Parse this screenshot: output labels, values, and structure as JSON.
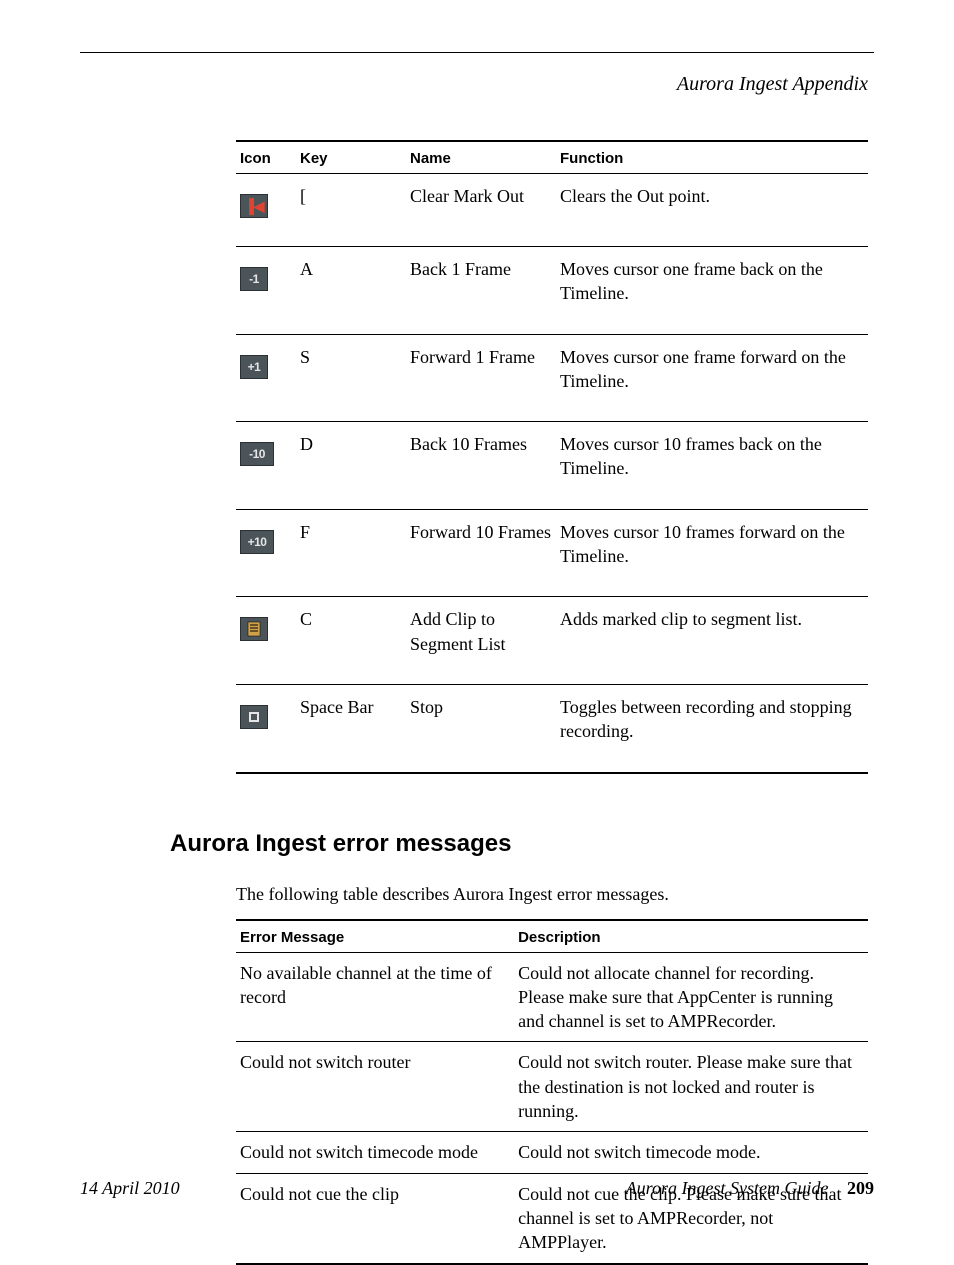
{
  "header": {
    "title": "Aurora Ingest Appendix"
  },
  "table1": {
    "headers": {
      "icon": "Icon",
      "key": "Key",
      "name": "Name",
      "function": "Function"
    },
    "rows": [
      {
        "icon_name": "clear-mark-out-icon",
        "icon_label": "",
        "icon_kind": "red-start",
        "key": "[",
        "name": "Clear Mark Out",
        "function": "Clears the Out point."
      },
      {
        "icon_name": "back-1-frame-icon",
        "icon_label": "-1",
        "icon_kind": "text",
        "key": "A",
        "name": "Back 1 Frame",
        "function": "Moves cursor one frame back on the Timeline."
      },
      {
        "icon_name": "forward-1-frame-icon",
        "icon_label": "+1",
        "icon_kind": "text",
        "key": "S",
        "name": "Forward 1 Frame",
        "function": "Moves cursor one frame forward on the Timeline."
      },
      {
        "icon_name": "back-10-frames-icon",
        "icon_label": "-10",
        "icon_kind": "text-wide",
        "key": "D",
        "name": "Back 10 Frames",
        "function": "Moves cursor 10 frames back on the Timeline."
      },
      {
        "icon_name": "forward-10-frames-icon",
        "icon_label": "+10",
        "icon_kind": "text-wide",
        "key": "F",
        "name": "Forward 10 Frames",
        "function": "Moves cursor 10 frames forward on the Timeline."
      },
      {
        "icon_name": "add-clip-to-segment-list-icon",
        "icon_label": "",
        "icon_kind": "doc",
        "key": "C",
        "name": "Add Clip to Segment List",
        "function": "Adds marked clip to segment list."
      },
      {
        "icon_name": "stop-icon",
        "icon_label": "",
        "icon_kind": "stop",
        "key": "Space Bar",
        "name": "Stop",
        "function": "Toggles between recording and stopping recording."
      }
    ]
  },
  "section2": {
    "heading": "Aurora Ingest error messages",
    "lead": "The following table describes Aurora Ingest error messages."
  },
  "table2": {
    "headers": {
      "error": "Error Message",
      "description": "Description"
    },
    "rows": [
      {
        "error": "No available channel at the time of record",
        "description": "Could not allocate channel for recording. Please make sure that AppCenter is running and channel is set to AMPRecorder."
      },
      {
        "error": "Could not switch router",
        "description": "Could not switch router. Please make sure that the destination is not locked and router is running."
      },
      {
        "error": "Could not switch timecode mode",
        "description": "Could not switch timecode mode."
      },
      {
        "error": "Could not cue the clip",
        "description": "Could not cue the clip. Please make sure that channel is set to AMPRecorder, not AMPPlayer."
      }
    ]
  },
  "footer": {
    "date": "14 April 2010",
    "guide": "Aurora Ingest System Guide",
    "page": "209"
  }
}
